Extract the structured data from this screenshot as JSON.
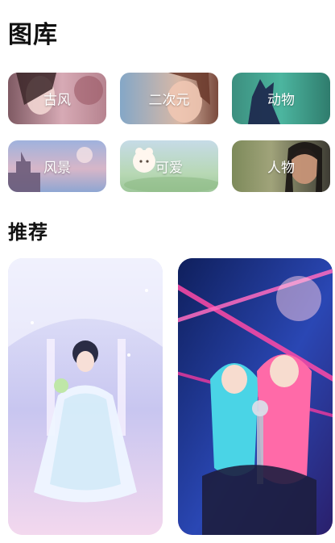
{
  "header": {
    "title": "图库"
  },
  "categories": [
    {
      "label": "古风"
    },
    {
      "label": "二次元"
    },
    {
      "label": "动物"
    },
    {
      "label": "风景"
    },
    {
      "label": "可爱"
    },
    {
      "label": "人物"
    }
  ],
  "recommend": {
    "title": "推荐"
  }
}
